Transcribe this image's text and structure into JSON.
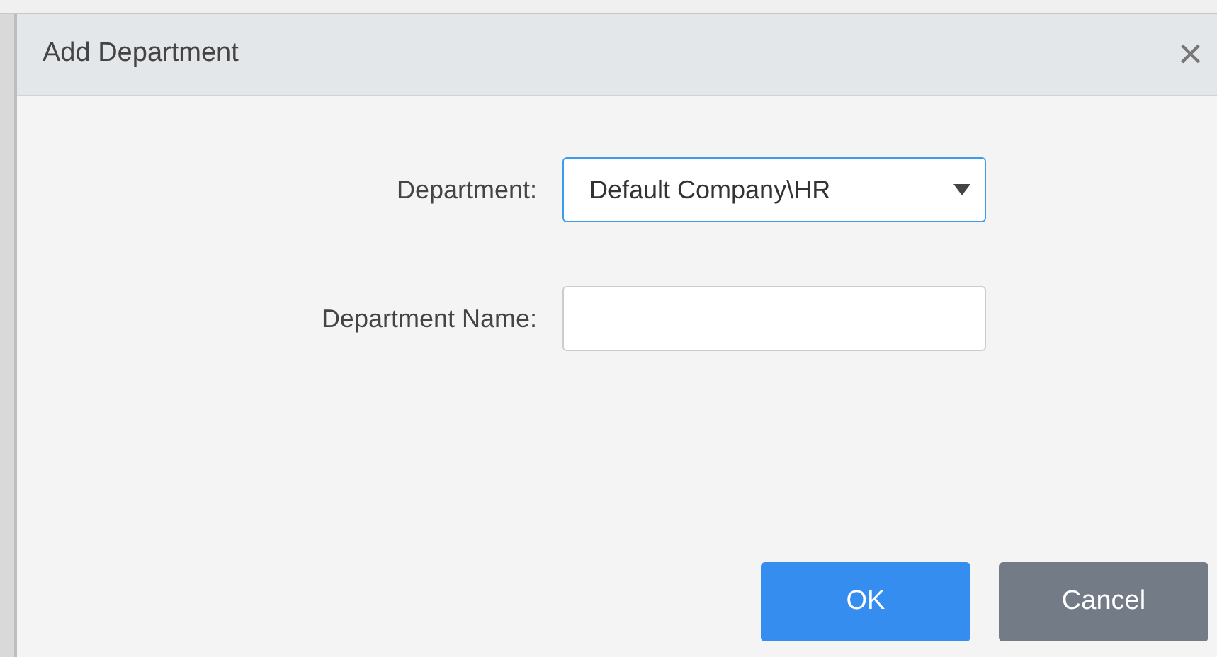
{
  "dialog": {
    "title": "Add Department",
    "close": "×"
  },
  "fields": [
    {
      "kind": "select",
      "label": "Department:",
      "value": "Default Company\\HR",
      "focused": true
    },
    {
      "kind": "text",
      "label": "Department Name:",
      "focused": false
    }
  ],
  "buttons": [
    {
      "kind": "primary",
      "label": "OK"
    },
    {
      "kind": "secondary",
      "label": "Cancel"
    }
  ]
}
